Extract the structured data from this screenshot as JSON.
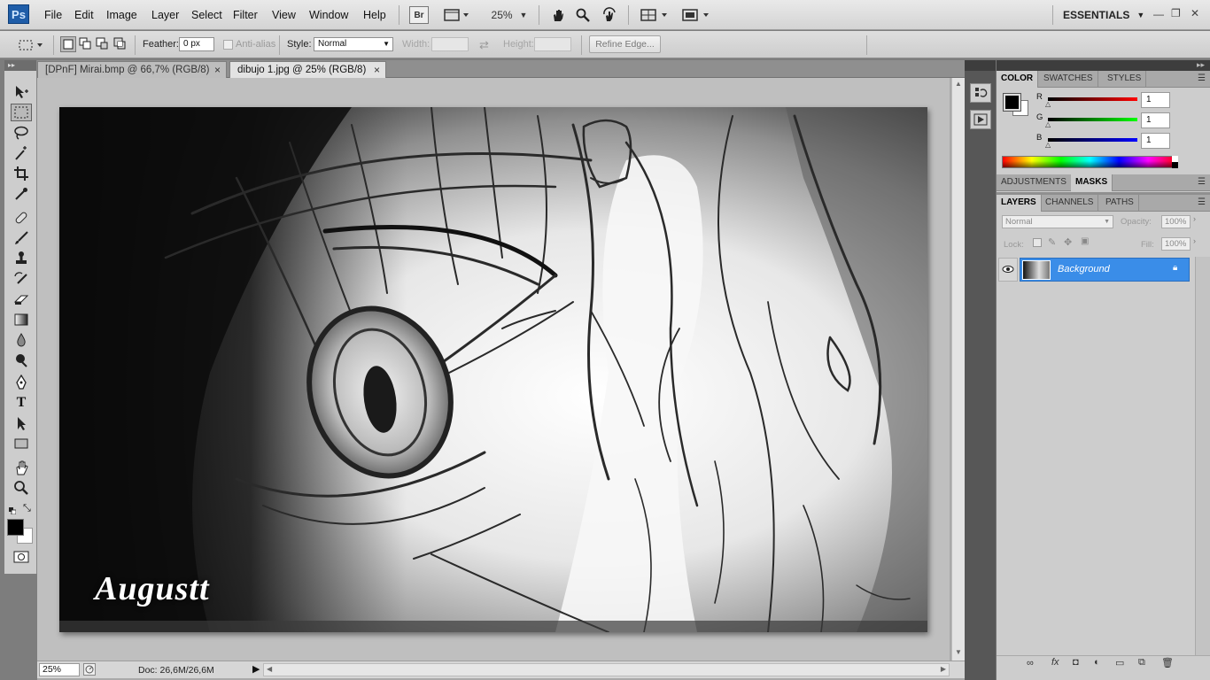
{
  "app": {
    "logo": "Ps",
    "menu": [
      "File",
      "Edit",
      "Image",
      "Layer",
      "Select",
      "Filter",
      "View",
      "Window",
      "Help"
    ],
    "bridge_label": "Br",
    "zoom_display": "25%",
    "workspace": "ESSENTIALS",
    "window_controls": {
      "minimize": "—",
      "restore": "❐",
      "close": "✕"
    }
  },
  "options": {
    "feather_label": "Feather:",
    "feather_value": "0 px",
    "anti_alias_label": "Anti-alias",
    "style_label": "Style:",
    "style_value": "Normal",
    "width_label": "Width:",
    "height_label": "Height:",
    "refine_edge": "Refine Edge..."
  },
  "tabs": [
    {
      "label": "[DPnF] Mirai.bmp @ 66,7% (RGB/8)",
      "close": "×",
      "active": false
    },
    {
      "label": "dibujo 1.jpg @ 25% (RGB/8)",
      "close": "×",
      "active": true
    }
  ],
  "artwork": {
    "signature": "Augustt"
  },
  "status": {
    "zoom": "25%",
    "doc": "Doc: 26,6M/26,6M"
  },
  "color_panel": {
    "tabs": [
      "COLOR",
      "SWATCHES",
      "STYLES"
    ],
    "channels": [
      {
        "label": "R",
        "value": "1",
        "color": "#d41616"
      },
      {
        "label": "G",
        "value": "1",
        "color": "#17b817"
      },
      {
        "label": "B",
        "value": "1",
        "color": "#1616d4"
      }
    ]
  },
  "adjust_panel": {
    "tabs": [
      "ADJUSTMENTS",
      "MASKS"
    ]
  },
  "layers_panel": {
    "tabs": [
      "LAYERS",
      "CHANNELS",
      "PATHS"
    ],
    "blend_mode": "Normal",
    "opacity_label": "Opacity:",
    "opacity_value": "100%",
    "lock_label": "Lock:",
    "fill_label": "Fill:",
    "fill_value": "100%",
    "layer_name": "Background"
  },
  "colors": {
    "selection": "#3a8de8",
    "foreground": "#000000",
    "background": "#ffffff"
  }
}
